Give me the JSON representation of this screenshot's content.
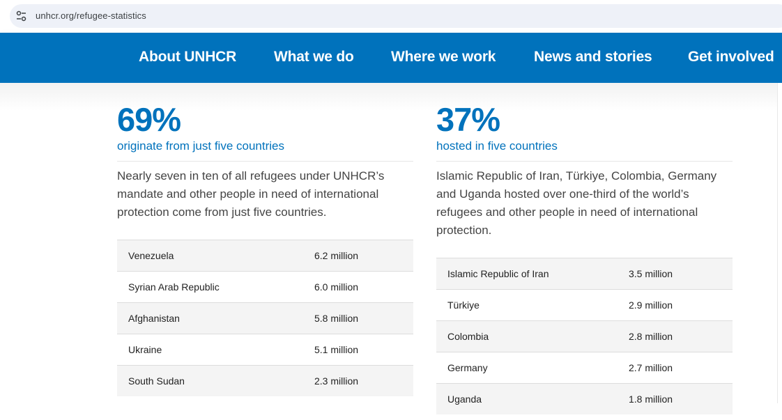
{
  "browser": {
    "url": "unhcr.org/refugee-statistics",
    "site_icon": "tune-icon"
  },
  "nav": {
    "items": [
      {
        "label": "About UNHCR"
      },
      {
        "label": "What we do"
      },
      {
        "label": "Where we work"
      },
      {
        "label": "News and stories"
      },
      {
        "label": "Get involved"
      }
    ]
  },
  "colors": {
    "brand": "#0072bc",
    "row_shade": "#f4f4f4"
  },
  "left": {
    "stat": "69%",
    "subtitle": "originate from just five countries",
    "description": "Nearly seven in ten of all refugees under UNHCR’s mandate and other people in need of international protection come from just five countries.",
    "rows": [
      {
        "country": "Venezuela",
        "value": "6.2 million"
      },
      {
        "country": "Syrian Arab Republic",
        "value": "6.0 million"
      },
      {
        "country": "Afghanistan",
        "value": "5.8 million"
      },
      {
        "country": "Ukraine",
        "value": "5.1 million"
      },
      {
        "country": "South Sudan",
        "value": "2.3 million"
      }
    ]
  },
  "right": {
    "stat": "37%",
    "subtitle": "hosted in five countries",
    "description": "Islamic Republic of Iran, Türkiye, Colombia, Germany and Uganda hosted over one-third of the world’s refugees and other people in need of international protection.",
    "rows": [
      {
        "country": "Islamic Republic of Iran",
        "value": "3.5 million"
      },
      {
        "country": "Türkiye",
        "value": "2.9 million"
      },
      {
        "country": "Colombia",
        "value": "2.8 million"
      },
      {
        "country": "Germany",
        "value": "2.7 million"
      },
      {
        "country": "Uganda",
        "value": "1.8 million"
      }
    ]
  }
}
